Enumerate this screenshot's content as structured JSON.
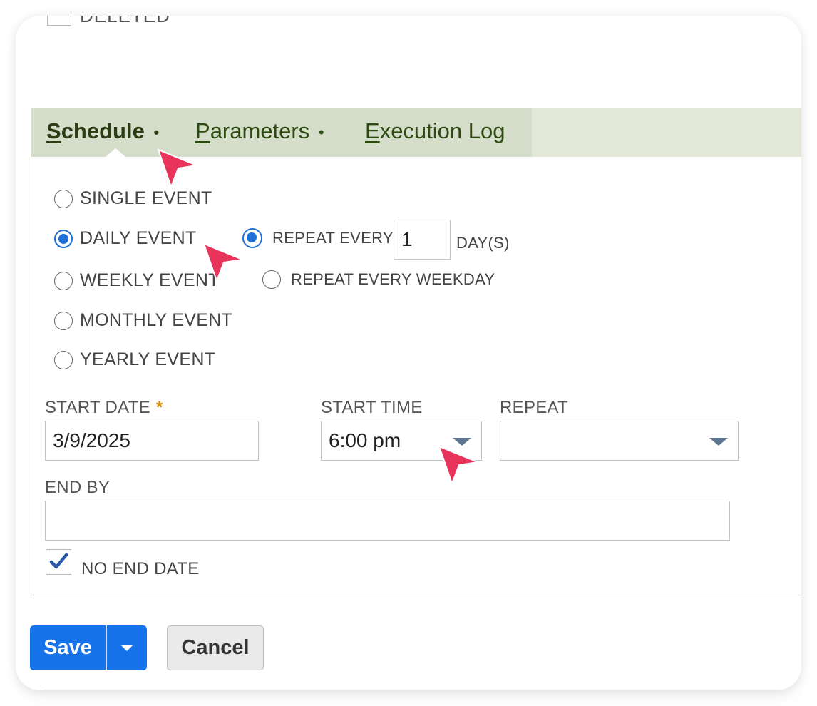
{
  "clipped_row": {
    "label": "DELETED"
  },
  "tabs": [
    {
      "key": "S",
      "rest": "chedule",
      "dot": "•"
    },
    {
      "key": "P",
      "rest": "arameters",
      "dot": "•"
    },
    {
      "key": "E",
      "rest": "xecution Log",
      "dot": ""
    }
  ],
  "frequency": {
    "options": [
      {
        "label": "SINGLE EVENT",
        "checked": false
      },
      {
        "label": "DAILY EVENT",
        "checked": true
      },
      {
        "label": "WEEKLY EVENT",
        "checked": false
      },
      {
        "label": "MONTHLY EVENT",
        "checked": false
      },
      {
        "label": "YEARLY EVENT",
        "checked": false
      }
    ]
  },
  "daily": {
    "repeat_every_label": "REPEAT EVERY",
    "repeat_every_value": "1",
    "days_unit": "DAY(S)",
    "weekday_label": "REPEAT EVERY WEEKDAY"
  },
  "start_date": {
    "label": "START DATE",
    "required_mark": "*",
    "value": "3/9/2025"
  },
  "start_time": {
    "label": "START TIME",
    "value": "6:00 pm"
  },
  "repeat": {
    "label": "REPEAT",
    "value": ""
  },
  "end_by": {
    "label": "END BY",
    "value": ""
  },
  "no_end_date": {
    "label": "NO END DATE",
    "checked": true
  },
  "buttons": {
    "save": "Save",
    "cancel": "Cancel"
  },
  "colors": {
    "accent": "#1673ea",
    "cursor": "#e8335a",
    "tab_text": "#2d4a11"
  }
}
